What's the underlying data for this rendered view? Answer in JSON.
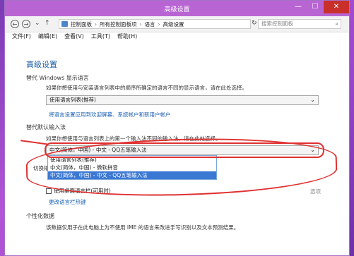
{
  "window": {
    "title": "高级设置",
    "min": "—",
    "max": "☐",
    "close": "✕"
  },
  "address": {
    "back": "←",
    "forward": "→",
    "recent": "⌄",
    "up": "↑",
    "crumbs": [
      "控制面板",
      "所有控制面板项",
      "语言",
      "高级设置"
    ],
    "crumb_sep": "›",
    "refresh": "↻",
    "search_placeholder": "搜索控制面板",
    "search_icon": "⌕"
  },
  "menu": [
    "文件(F)",
    "编辑(E)",
    "查看(V)",
    "工具(T)",
    "帮助(H)"
  ],
  "page": {
    "heading": "高级设置",
    "display_lang": {
      "title": "替代 Windows 显示语言",
      "desc": "如果你想使用与安装语言列表中的顺序所确定的语言不同的显示语言，请在此处选择。",
      "value": "使用语言列表(推荐)",
      "link": "将语言设置应用到欢迎屏幕、系统帐户和新用户帐户"
    },
    "default_input": {
      "title": "替代默认输入法",
      "desc": "如果你想使用与语言列表上的第一个输入法不同的输入法，请在此处选择。",
      "value": "中文(简体，中国) - 中文 - QQ五笔输入法",
      "options": [
        "使用语言列表(推荐)",
        "中文(简体，中国) - 微软拼音",
        "中文(简体，中国) - 中文 - QQ五笔输入法"
      ],
      "selected_index": 2
    },
    "switch_label": "切换输",
    "checkbox_label": "使用桌面语言栏(可用时)",
    "options_label": "选项",
    "hotkey_link": "更改语言栏热键",
    "personal": {
      "title": "个性化数据",
      "desc": "该数据仅用于在此电脑上为不使用 IME 的语言来改进手写识别以及文本预测结果。"
    }
  },
  "colors": {
    "titlebar": "#b865d3",
    "annotation": "#e03030",
    "selected_option": "#3b78d4",
    "heading": "#1d5fa8"
  }
}
